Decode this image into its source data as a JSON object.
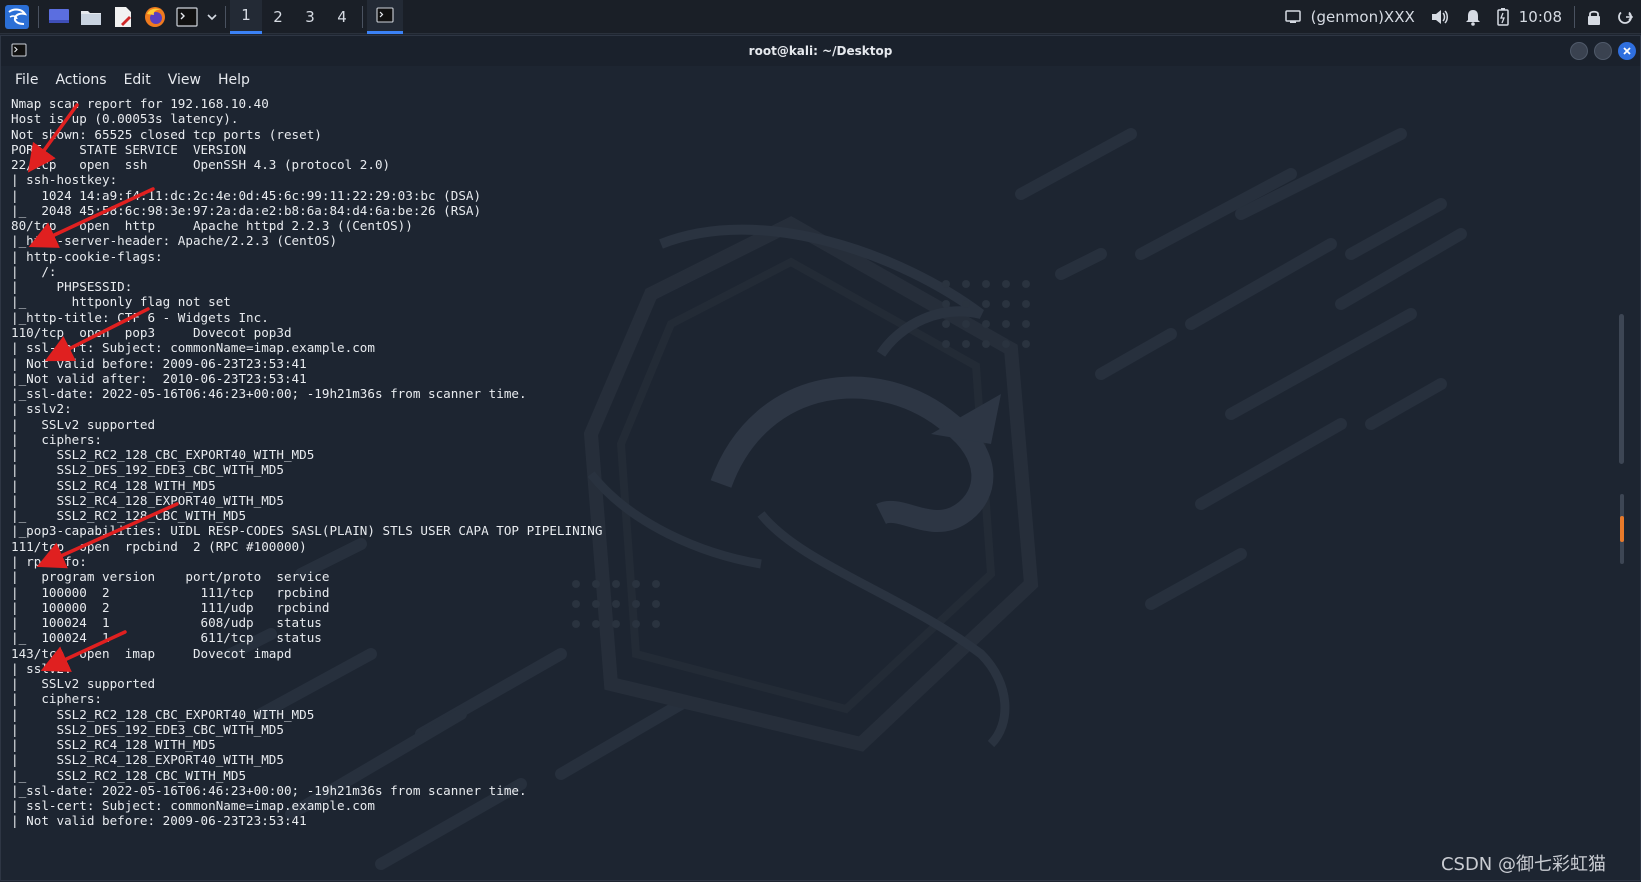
{
  "panel": {
    "workspaces": [
      "1",
      "2",
      "3",
      "4"
    ],
    "active_workspace": "1",
    "genmon_label": "(genmon)XXX",
    "clock": "10:08"
  },
  "window": {
    "title": "root@kali: ~/Desktop",
    "menu": [
      "File",
      "Actions",
      "Edit",
      "View",
      "Help"
    ]
  },
  "terminal": {
    "lines": [
      "Nmap scan report for 192.168.10.40",
      "Host is up (0.00053s latency).",
      "Not shown: 65525 closed tcp ports (reset)",
      "PORT     STATE SERVICE  VERSION",
      "22/tcp   open  ssh      OpenSSH 4.3 (protocol 2.0)",
      "| ssh-hostkey:",
      "|   1024 14:a9:f4:11:dc:2c:4e:0d:45:6c:99:11:22:29:03:bc (DSA)",
      "|_  2048 45:58:6c:98:3e:97:2a:da:e2:b8:6a:84:d4:6a:be:26 (RSA)",
      "80/tcp   open  http     Apache httpd 2.2.3 ((CentOS))",
      "|_http-server-header: Apache/2.2.3 (CentOS)",
      "| http-cookie-flags:",
      "|   /:",
      "|     PHPSESSID:",
      "|_      httponly flag not set",
      "|_http-title: CTF 6 - Widgets Inc.",
      "110/tcp  open  pop3     Dovecot pop3d",
      "| ssl-cert: Subject: commonName=imap.example.com",
      "| Not valid before: 2009-06-23T23:53:41",
      "|_Not valid after:  2010-06-23T23:53:41",
      "|_ssl-date: 2022-05-16T06:46:23+00:00; -19h21m36s from scanner time.",
      "| sslv2:",
      "|   SSLv2 supported",
      "|   ciphers:",
      "|     SSL2_RC2_128_CBC_EXPORT40_WITH_MD5",
      "|     SSL2_DES_192_EDE3_CBC_WITH_MD5",
      "|     SSL2_RC4_128_WITH_MD5",
      "|     SSL2_RC4_128_EXPORT40_WITH_MD5",
      "|_    SSL2_RC2_128_CBC_WITH_MD5",
      "|_pop3-capabilities: UIDL RESP-CODES SASL(PLAIN) STLS USER CAPA TOP PIPELINING",
      "111/tcp  open  rpcbind  2 (RPC #100000)",
      "| rpcinfo:",
      "|   program version    port/proto  service",
      "|   100000  2            111/tcp   rpcbind",
      "|   100000  2            111/udp   rpcbind",
      "|   100024  1            608/udp   status",
      "|_  100024  1            611/tcp   status",
      "143/tcp  open  imap     Dovecot imapd",
      "| sslv2:",
      "|   SSLv2 supported",
      "|   ciphers:",
      "|     SSL2_RC2_128_CBC_EXPORT40_WITH_MD5",
      "|     SSL2_DES_192_EDE3_CBC_WITH_MD5",
      "|     SSL2_RC4_128_WITH_MD5",
      "|     SSL2_RC4_128_EXPORT40_WITH_MD5",
      "|_    SSL2_RC2_128_CBC_WITH_MD5",
      "|_ssl-date: 2022-05-16T06:46:23+00:00; -19h21m36s from scanner time.",
      "| ssl-cert: Subject: commonName=imap.example.com",
      "| Not valid before: 2009-06-23T23:53:41"
    ]
  },
  "watermark": "CSDN @御七彩虹猫",
  "colors": {
    "panel_bg": "#1a1f27",
    "terminal_bg": "#1d2531",
    "accent": "#3b82f6",
    "annotation_arrow": "#e02020"
  }
}
